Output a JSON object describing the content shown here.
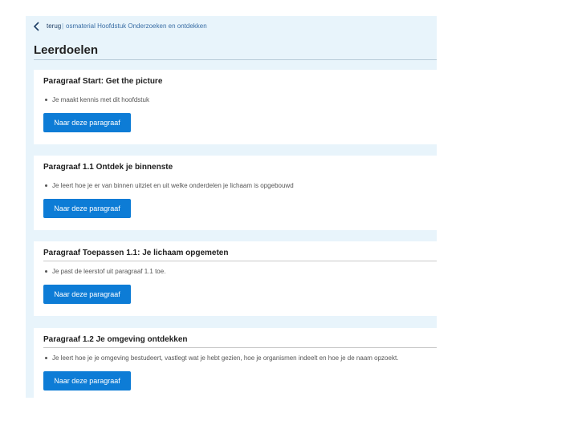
{
  "topbar": {
    "back_label": "terug",
    "breadcrumb": "osmaterial Hoofdstuk Onderzoeken en ontdekken"
  },
  "page": {
    "title": "Leerdoelen"
  },
  "cards": [
    {
      "title": "Paragraaf Start: Get the picture",
      "bullet": "Je maakt kennis met dit hoofdstuk",
      "button": "Naar deze paragraaf"
    },
    {
      "title": "Paragraaf 1.1 Ontdek je binnenste",
      "bullet": "Je leert hoe je er van binnen uitziet en uit welke onderdelen je lichaam is opgebouwd",
      "button": "Naar deze paragraaf"
    },
    {
      "title": "Paragraaf Toepassen 1.1: Je lichaam opgemeten",
      "bullet": "Je past de leerstof uit paragraaf 1.1 toe.",
      "button": "Naar deze paragraaf"
    },
    {
      "title": "Paragraaf 1.2 Je omgeving ontdekken",
      "bullet": "Je leert hoe je je omgeving bestudeert, vastlegt wat je hebt gezien, hoe je organismen indeelt en hoe je de naam opzoekt.",
      "button": "Naar deze paragraaf"
    }
  ]
}
